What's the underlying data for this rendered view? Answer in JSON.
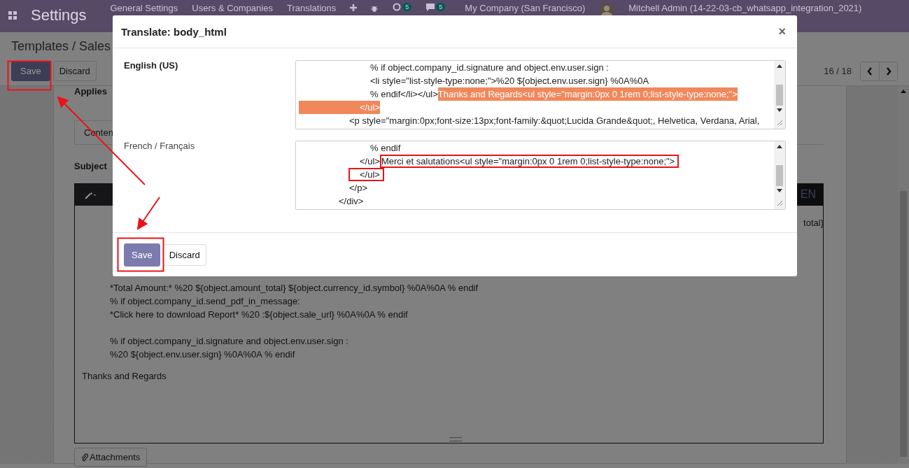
{
  "navbar": {
    "app_title": "Settings",
    "menu": [
      "General Settings",
      "Users & Companies",
      "Translations"
    ],
    "badges": [
      "5",
      "5"
    ],
    "company": "My Company (San Francisco)",
    "user": "Mitchell Admin (14-22-03-cb_whatsapp_integration_2021)"
  },
  "breadcrumb": "Templates / Sales",
  "buttons": [
    "Save",
    "Discard"
  ],
  "pager": "16 / 18",
  "form": {
    "field_label": "Applies",
    "tab": "Conten",
    "subject_label": "Subject",
    "editor": {
      "language": "EN",
      "cut_right": "total}",
      "paragraphs": [
        [
          "*Total Amount:* %20 ${object.amount_total} ${object.currency_id.symbol} %0A%0A % endif",
          "% if object.company_id.send_pdf_in_message:",
          "*Click here to download Report* %20 :${object.sale_url} %0A%0A % endif"
        ],
        [
          "% if object.company_id.signature and object.env.user.sign :",
          "%20 ${object.env.user.sign} %0A%0A % endif"
        ]
      ],
      "closing": "Thanks and Regards"
    },
    "attachments_button": "Attachments"
  },
  "dialog": {
    "title": "Translate: body_html",
    "close": "×",
    "rows": [
      {
        "language": "English (US)",
        "source": true,
        "lines": [
          [
            {
              "text": "% if object.company_id.signature and object.env.user.sign :",
              "highlighted": false,
              "annotated": false
            }
          ],
          [
            {
              "text": "<li style=\"list-style-type:none;\">%20 ${object.env.user.sign} %0A%0A",
              "highlighted": false,
              "annotated": false
            }
          ],
          [
            {
              "text": "% endif</li></ul>",
              "highlighted": false,
              "annotated": false
            },
            {
              "text": "Thanks and Regards<ul style=\"margin:0px 0 1rem 0;list-style-type:none;\">",
              "highlighted": true,
              "annotated": false
            }
          ],
          [
            {
              "text": "</ul>",
              "highlighted": true,
              "annotated": false
            }
          ],
          [
            {
              "text": "<p style=\"margin:0px;font-size:13px;font-family:&quot;Lucida Grande&quot;, Helvetica, Verdana, Arial,",
              "highlighted": false,
              "annotated": false
            }
          ]
        ]
      },
      {
        "language": "French / Français",
        "source": false,
        "lines": [
          [
            {
              "text": "% endif",
              "highlighted": false,
              "annotated": false
            }
          ],
          [
            {
              "text": "</ul>",
              "highlighted": false,
              "annotated": false
            },
            {
              "text": "Merci et salutations<ul style=\"margin:0px 0 1rem 0;list-style-type:none;\">",
              "highlighted": false,
              "annotated": true
            }
          ],
          [
            {
              "text": "</ul>",
              "highlighted": false,
              "annotated": true
            }
          ],
          [
            {
              "text": "</p>",
              "highlighted": false,
              "annotated": false
            }
          ],
          [
            {
              "text": "</div>",
              "highlighted": false,
              "annotated": false
            }
          ]
        ]
      }
    ],
    "buttons": [
      "Save",
      "Discard"
    ]
  }
}
